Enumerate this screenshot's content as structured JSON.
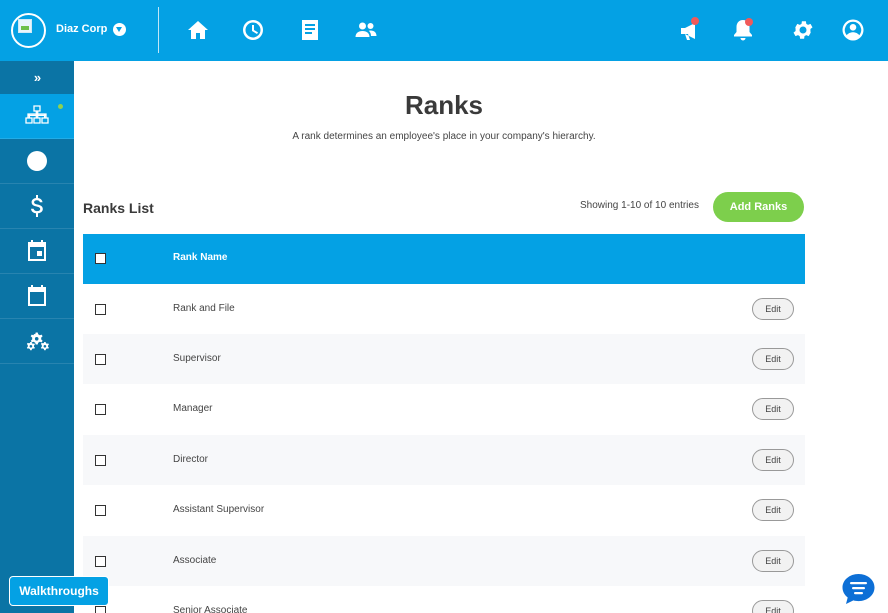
{
  "header": {
    "company": "Diaz Corp",
    "icons": [
      "home-icon",
      "clock-icon",
      "document-icon",
      "users-icon",
      "megaphone-icon",
      "bell-icon",
      "gear-icon",
      "account-icon"
    ]
  },
  "sidebar": {
    "toggle": "»",
    "items": [
      "org-chart-icon",
      "clock-icon",
      "dollar-icon",
      "calendar-event-icon",
      "calendar-icon",
      "gears-icon"
    ]
  },
  "walkthroughs_label": "Walkthroughs",
  "page": {
    "title": "Ranks",
    "subtitle": "A rank determines an employee's place in your company's hierarchy."
  },
  "list": {
    "title": "Ranks List",
    "showing": "Showing 1-10 of 10 entries",
    "add_label": "Add Ranks",
    "column_name": "Rank Name",
    "edit_label": "Edit",
    "rows": [
      "Rank and File",
      "Supervisor",
      "Manager",
      "Director",
      "Assistant Supervisor",
      "Associate",
      "Senior Associate"
    ]
  },
  "colors": {
    "primary": "#04a1e4",
    "sidebar": "#0b74a5",
    "accent_green": "#7dcf4c",
    "notification_red": "#f05a5a"
  }
}
